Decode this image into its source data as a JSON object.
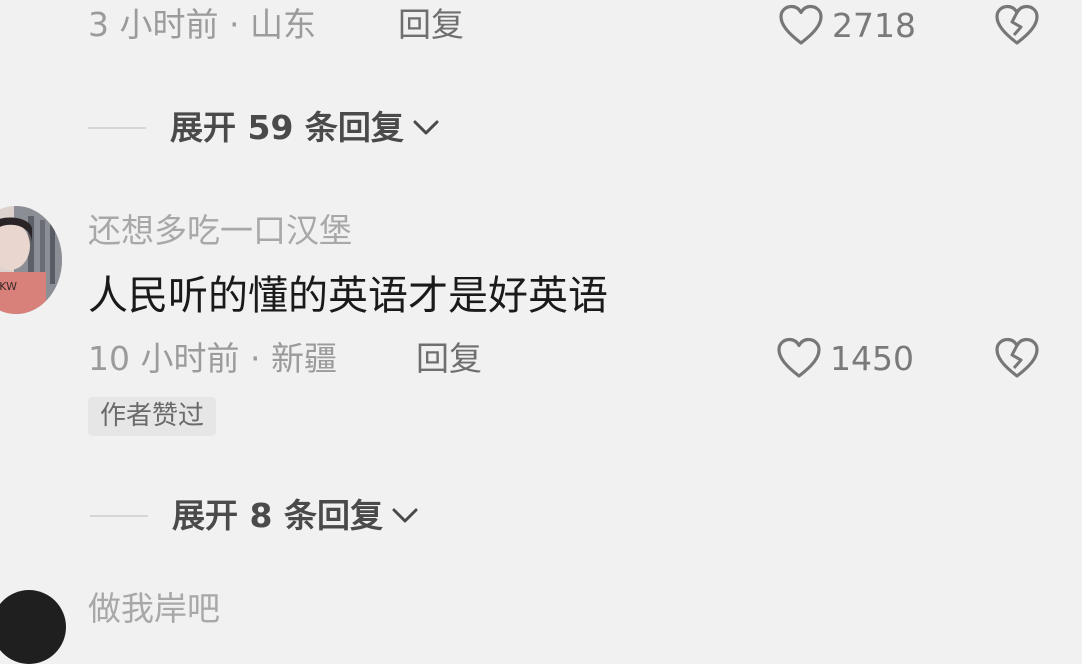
{
  "comment_1": {
    "meta": "3 小时前 · 山东",
    "reply_label": "回复",
    "likes": "2718",
    "expand_label": "展开 59 条回复"
  },
  "comment_2": {
    "username": "还想多吃一口汉堡",
    "text": "人民听的懂的英语才是好英语",
    "meta": "10 小时前 · 新疆",
    "reply_label": "回复",
    "likes": "1450",
    "badge": "作者赞过",
    "expand_label": "展开 8 条回复"
  },
  "comment_3": {
    "username": "做我岸吧"
  },
  "icons": {
    "like": "heart-outline-icon",
    "dislike": "broken-heart-icon",
    "expand": "chevron-down-icon"
  },
  "colors": {
    "background": "#f1f1f1",
    "meta_text": "#9b9b9b",
    "body_text": "#1a1a1a"
  }
}
